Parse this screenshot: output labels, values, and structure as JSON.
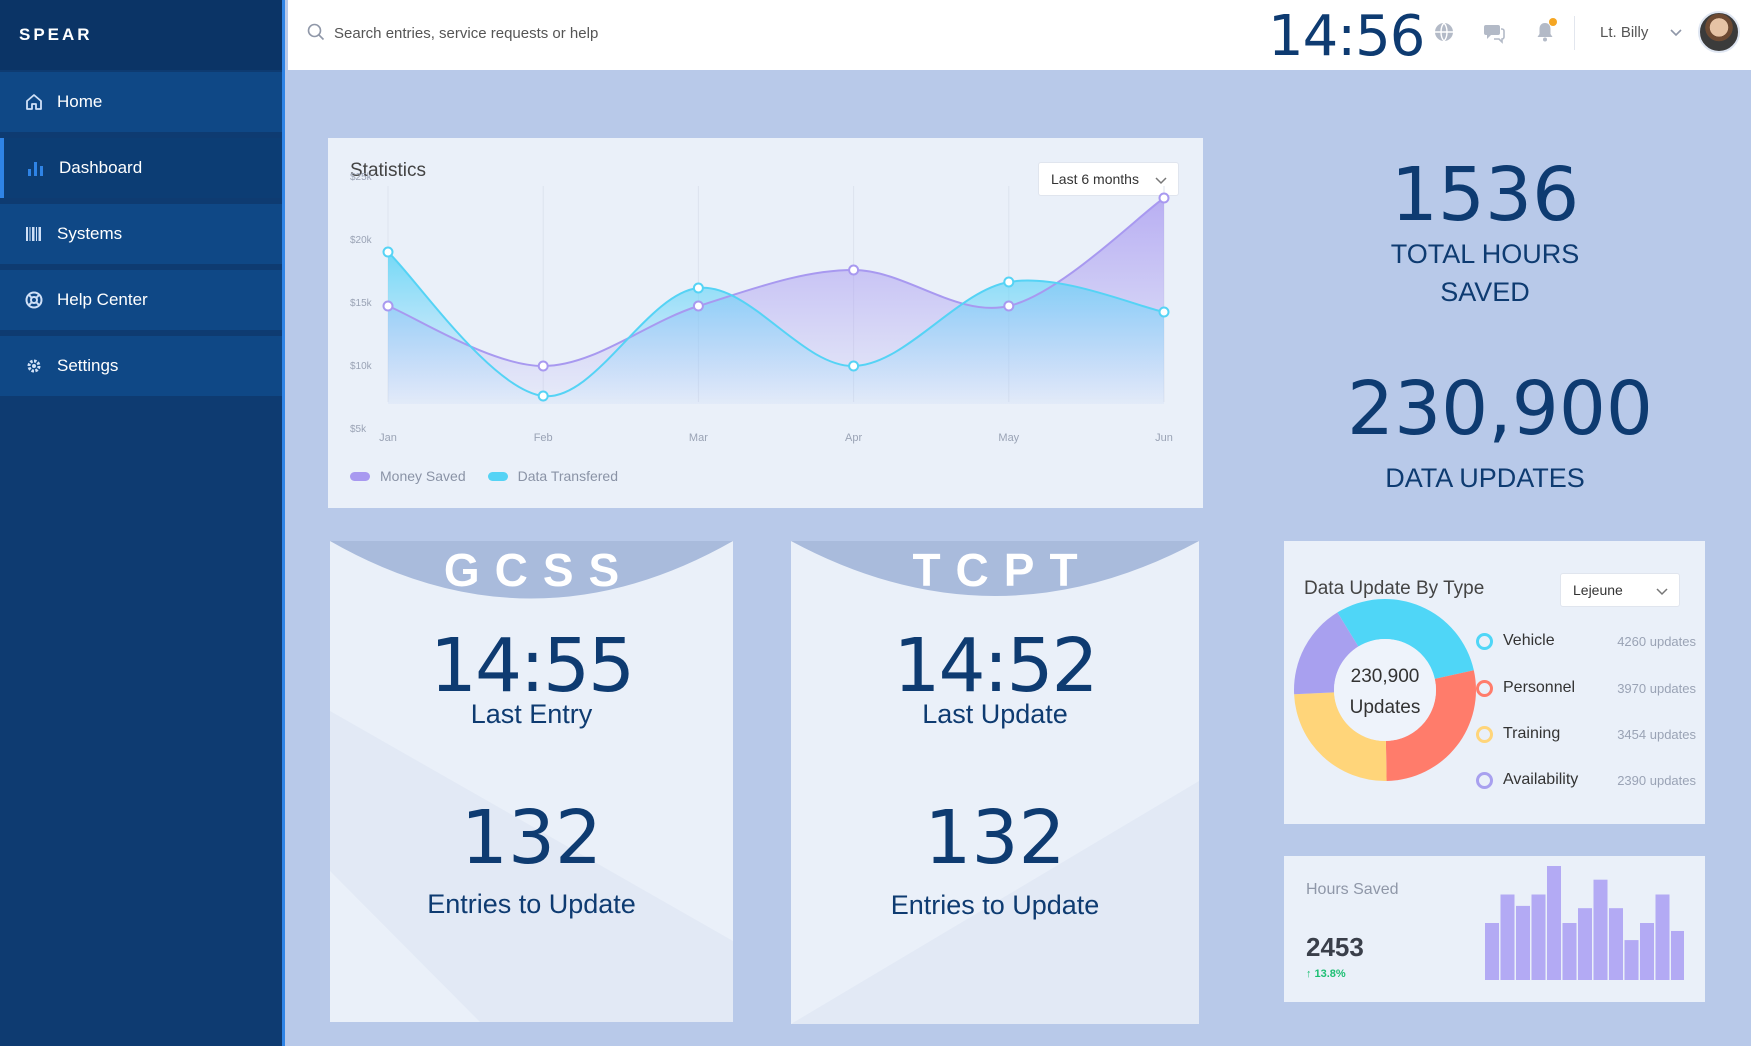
{
  "app": {
    "logo": "SPEAR"
  },
  "sidebar": {
    "items": [
      {
        "label": "Home",
        "icon": "home-icon"
      },
      {
        "label": "Dashboard",
        "icon": "bar-chart-icon",
        "active": true
      },
      {
        "label": "Systems",
        "icon": "barcode-icon"
      },
      {
        "label": "Help Center",
        "icon": "lifebuoy-icon"
      },
      {
        "label": "Settings",
        "icon": "gear-icon"
      }
    ]
  },
  "topbar": {
    "search_placeholder": "Search entries, service requests or help",
    "clock": "14:56",
    "user_name": "Lt. Billy"
  },
  "statistics": {
    "title": "Statistics",
    "range_select": "Last 6 months"
  },
  "totals": {
    "hours_value": "1536",
    "hours_label_1": "TOTAL HOURS",
    "hours_label_2": "SAVED",
    "updates_value": "230,900",
    "updates_label": "DATA UPDATES"
  },
  "gcss": {
    "title": "GCSS",
    "time": "14:55",
    "time_label": "Last Entry",
    "count": "132",
    "count_label": "Entries to Update"
  },
  "tcpt": {
    "title": "TCPT",
    "time": "14:52",
    "time_label": "Last Update",
    "count": "132",
    "count_label": "Entries to Update"
  },
  "data_update_by_type": {
    "title": "Data Update By Type",
    "location_select": "Lejeune",
    "center_line1": "230,900",
    "center_line2": "Updates",
    "items": [
      {
        "name": "Vehicle",
        "value": "4260 updates",
        "color": "#4fd6f7"
      },
      {
        "name": "Personnel",
        "value": "3970 updates",
        "color": "#ff7c6b"
      },
      {
        "name": "Training",
        "value": "3454 updates",
        "color": "#ffd57a"
      },
      {
        "name": "Availability",
        "value": "2390 updates",
        "color": "#a8a0ef"
      }
    ]
  },
  "hours_saved": {
    "title": "Hours Saved",
    "value": "2453",
    "change": "13.8%",
    "change_color": "#1dbf73",
    "bar_color": "#b3aaf4",
    "bars": [
      50,
      75,
      65,
      75,
      100,
      50,
      63,
      88,
      63,
      35,
      50,
      75,
      43
    ]
  },
  "chart_data": {
    "type": "area",
    "title": "Statistics",
    "categories": [
      "Jan",
      "Feb",
      "Mar",
      "Apr",
      "May",
      "Jun"
    ],
    "y_ticks": [
      "$25k",
      "$20k",
      "$15k",
      "$10k",
      "$5k"
    ],
    "ylim": [
      5,
      25
    ],
    "series": [
      {
        "name": "Money Saved",
        "color": "#a899f0",
        "values": [
          15,
          10,
          15,
          18,
          15,
          24
        ]
      },
      {
        "name": "Data Transfered",
        "color": "#55d3f5",
        "values": [
          19.5,
          7.5,
          16.5,
          10,
          17,
          14.5
        ]
      }
    ],
    "legend": "bottom-left"
  }
}
